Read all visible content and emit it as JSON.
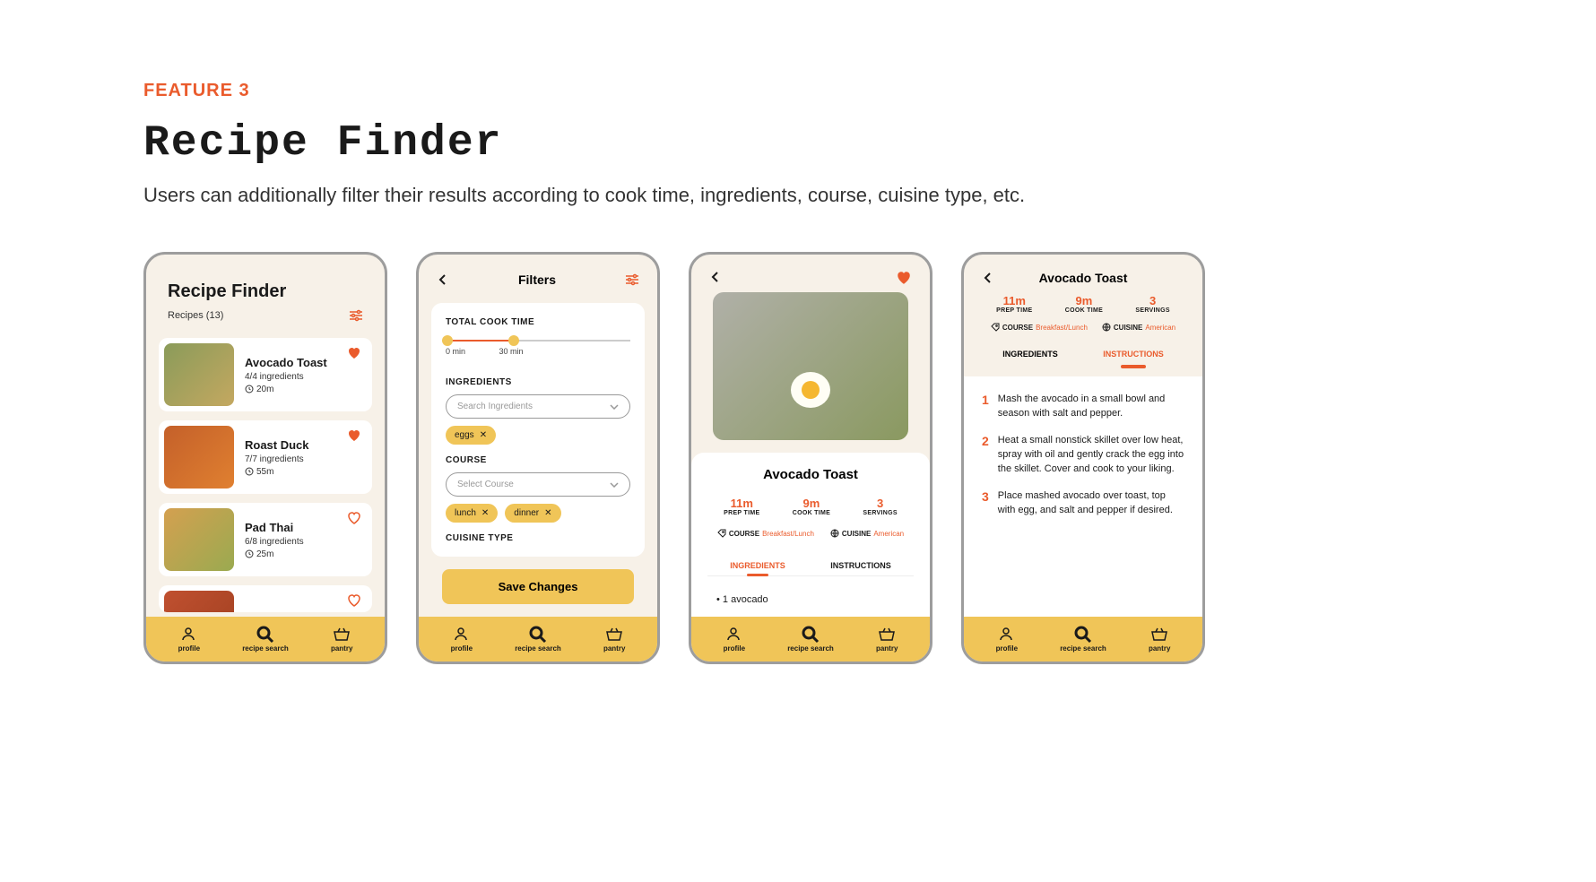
{
  "header": {
    "eyebrow": "FEATURE 3",
    "title": "Recipe Finder",
    "subtitle": "Users can additionally filter their results according to cook time, ingredients, course, cuisine type, etc."
  },
  "tabbar": {
    "profile": "profile",
    "search": "recipe search",
    "pantry": "pantry"
  },
  "screen1": {
    "title": "Recipe Finder",
    "count": "Recipes (13)",
    "recipes": [
      {
        "name": "Avocado Toast",
        "ingredients": "4/4 ingredients",
        "time": "20m",
        "fav": true
      },
      {
        "name": "Roast Duck",
        "ingredients": "7/7 ingredients",
        "time": "55m",
        "fav": true
      },
      {
        "name": "Pad Thai",
        "ingredients": "6/8 ingredients",
        "time": "25m",
        "fav": false
      }
    ]
  },
  "screen2": {
    "title": "Filters",
    "sections": {
      "cook_time": "TOTAL COOK TIME",
      "ingredients": "INGREDIENTS",
      "course": "COURSE",
      "cuisine": "CUISINE TYPE"
    },
    "slider": {
      "min": "0 min",
      "max": "30 min"
    },
    "ingredients_placeholder": "Search Ingredients",
    "ingredient_chips": [
      "eggs"
    ],
    "course_placeholder": "Select Course",
    "course_chips": [
      "lunch",
      "dinner"
    ],
    "save": "Save Changes"
  },
  "screen3": {
    "name": "Avocado Toast",
    "stats": {
      "prep": {
        "val": "11m",
        "lbl": "PREP TIME"
      },
      "cook": {
        "val": "9m",
        "lbl": "COOK TIME"
      },
      "serv": {
        "val": "3",
        "lbl": "SERVINGS"
      }
    },
    "meta": {
      "course_lbl": "COURSE",
      "course_val": "Breakfast/Lunch",
      "cuisine_lbl": "CUISINE",
      "cuisine_val": "American"
    },
    "tabs": {
      "ing": "INGREDIENTS",
      "inst": "INSTRUCTIONS"
    },
    "ing_item": "• 1 avocado"
  },
  "screen4": {
    "name": "Avocado Toast",
    "steps": [
      "Mash the avocado in a small bowl and season with salt and pepper.",
      "Heat a small nonstick skillet over low heat, spray with oil and gently crack the egg into the skillet. Cover and cook to your liking.",
      "Place mashed avocado over toast, top with egg, and salt and pepper if desired."
    ]
  }
}
